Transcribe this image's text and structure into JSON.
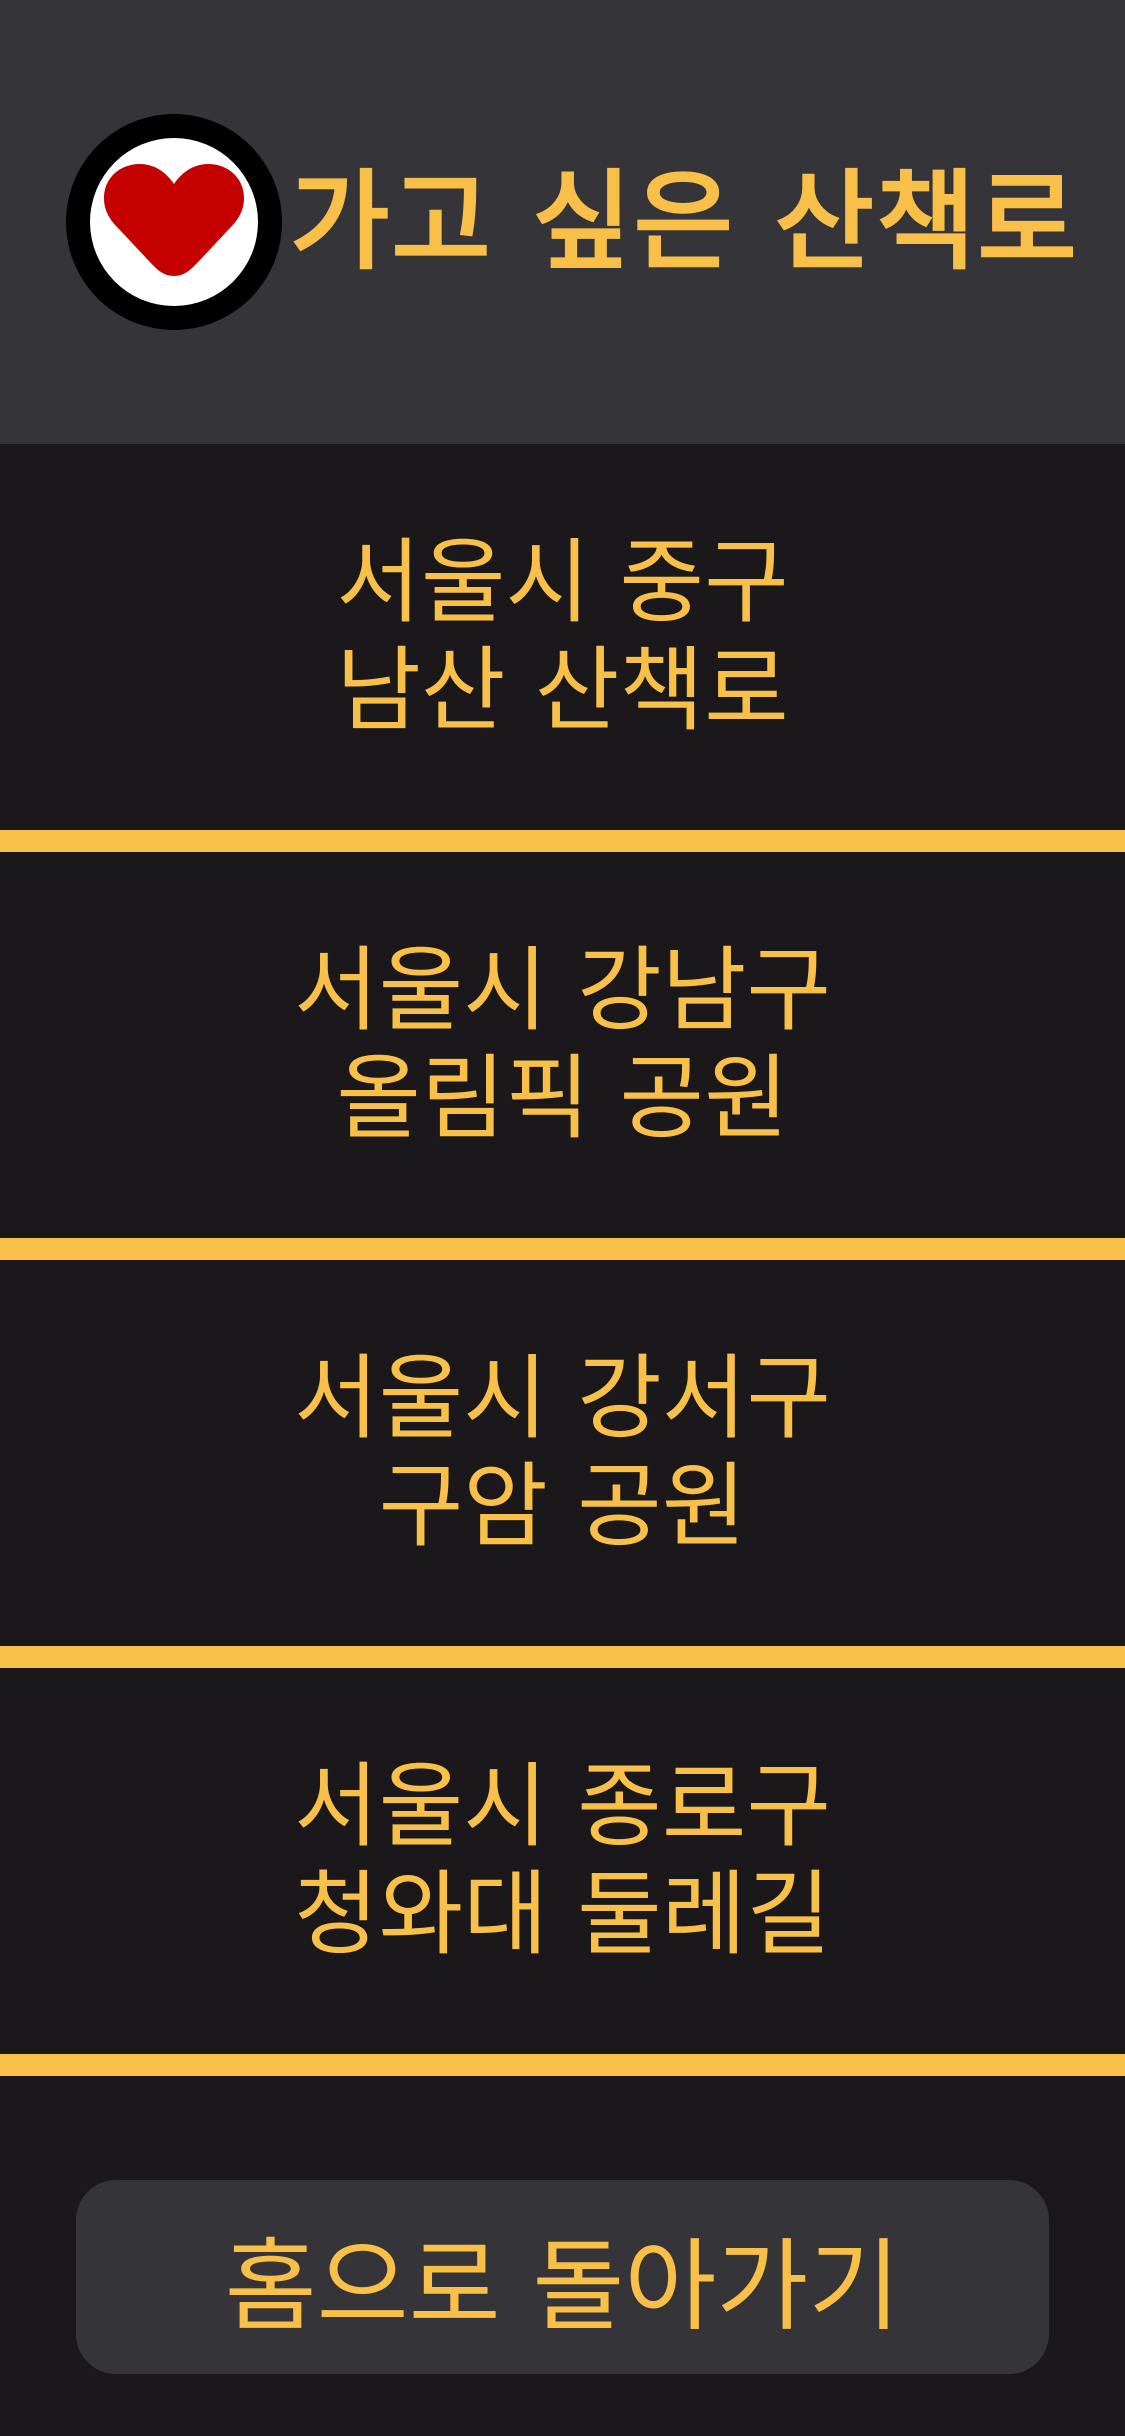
{
  "header": {
    "title": "가고 싶은 산책로",
    "icon": "heart-icon"
  },
  "colors": {
    "accent": "#f8c048",
    "header_bg": "#353438",
    "page_bg": "#1a181b",
    "heart": "#c40000"
  },
  "items": [
    {
      "line1": "서울시 중구",
      "line2": "남산 산책로"
    },
    {
      "line1": "서울시 강남구",
      "line2": "올림픽 공원"
    },
    {
      "line1": "서울시 강서구",
      "line2": "구암 공원"
    },
    {
      "line1": "서울시 종로구",
      "line2": "청와대 둘레길"
    }
  ],
  "footer": {
    "home_label": "홈으로 돌아가기"
  }
}
